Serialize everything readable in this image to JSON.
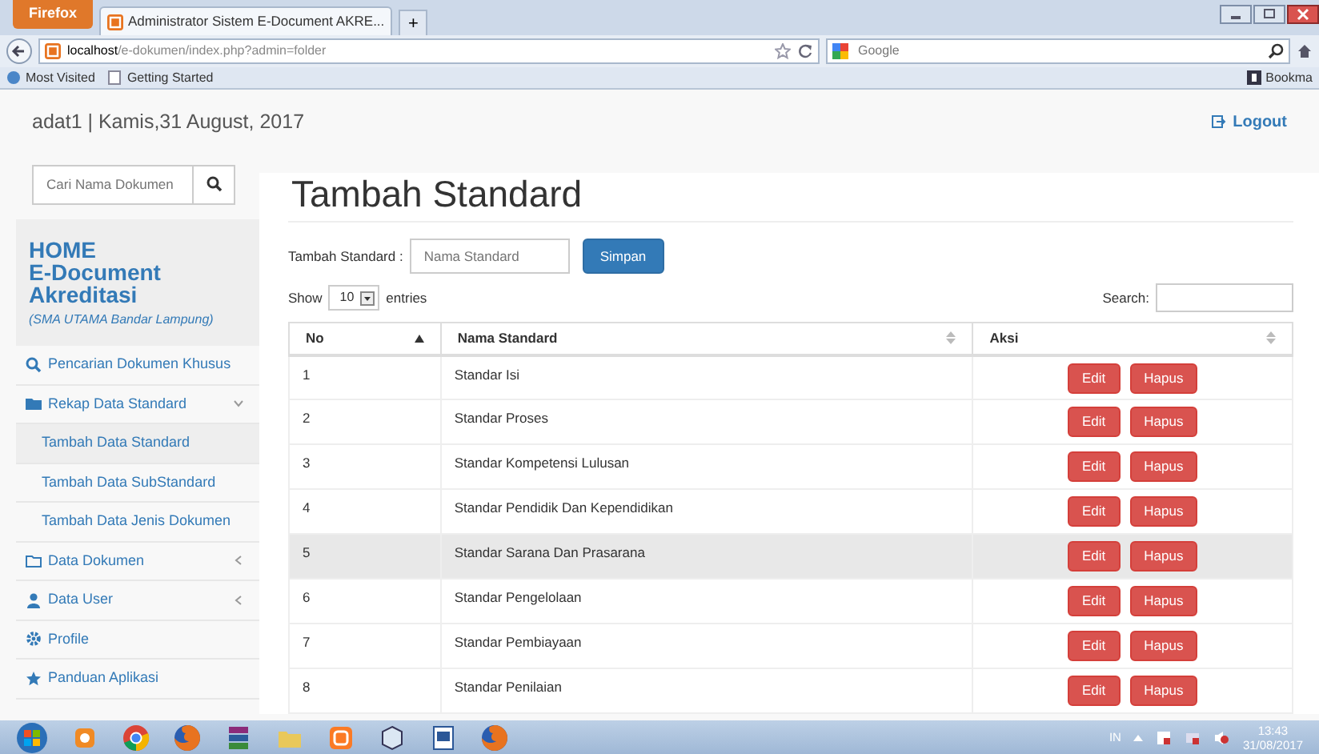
{
  "browser": {
    "menu_button": "Firefox",
    "tab_title": "Administrator Sistem E-Document AKRE...",
    "new_tab": "+",
    "url_host": "localhost",
    "url_path": "/e-dokumen/index.php?admin=folder",
    "search_engine": "Google",
    "bookmarks": [
      "Most Visited",
      "Getting Started"
    ],
    "bookmarks_menu": "Bookma"
  },
  "header": {
    "user_date": "adat1 | Kamis,31 August, 2017",
    "logout": "Logout"
  },
  "sidebar": {
    "search_placeholder": "Cari Nama Dokumen",
    "brand": [
      "HOME",
      "E-Document",
      "Akreditasi"
    ],
    "school": "(SMA UTAMA Bandar Lampung)",
    "items": [
      {
        "label": "Pencarian Dokumen Khusus",
        "kind": "link"
      },
      {
        "label": "Rekap Data Standard",
        "kind": "group",
        "expanded": true,
        "children": [
          {
            "label": "Tambah Data Standard",
            "selected": true
          },
          {
            "label": "Tambah Data SubStandard",
            "selected": false
          },
          {
            "label": "Tambah Data Jenis Dokumen",
            "selected": false
          }
        ]
      },
      {
        "label": "Data Dokumen",
        "kind": "group",
        "expanded": false
      },
      {
        "label": "Data User",
        "kind": "group",
        "expanded": false
      },
      {
        "label": "Profile",
        "kind": "link"
      },
      {
        "label": "Panduan Aplikasi",
        "kind": "link"
      }
    ]
  },
  "main": {
    "title": "Tambah Standard",
    "form": {
      "label": "Tambah Standard :",
      "placeholder": "Nama Standard",
      "button": "Simpan"
    },
    "length": {
      "show": "Show",
      "value": "10",
      "entries": "entries"
    },
    "search_label": "Search:",
    "table": {
      "columns": [
        {
          "label": "No",
          "sorted": true
        },
        {
          "label": "Nama Standard",
          "sorted": false
        },
        {
          "label": "Aksi",
          "sorted": false
        }
      ],
      "rows": [
        {
          "no": "1",
          "name": "Standar Isi",
          "highlighted": false,
          "actions": [
            "Edit",
            "Hapus"
          ]
        },
        {
          "no": "2",
          "name": "Standar Proses",
          "highlighted": false,
          "actions": [
            "Edit",
            "Hapus"
          ]
        },
        {
          "no": "3",
          "name": "Standar Kompetensi Lulusan",
          "highlighted": false,
          "actions": [
            "Edit",
            "Hapus"
          ]
        },
        {
          "no": "4",
          "name": "Standar Pendidik Dan Kependidikan",
          "highlighted": false,
          "actions": [
            "Edit",
            "Hapus"
          ]
        },
        {
          "no": "5",
          "name": "Standar Sarana Dan Prasarana",
          "highlighted": true,
          "actions": [
            "Edit",
            "Hapus"
          ]
        },
        {
          "no": "6",
          "name": "Standar Pengelolaan",
          "highlighted": false,
          "actions": [
            "Edit",
            "Hapus"
          ]
        },
        {
          "no": "7",
          "name": "Standar Pembiayaan",
          "highlighted": false,
          "actions": [
            "Edit",
            "Hapus"
          ]
        },
        {
          "no": "8",
          "name": "Standar Penilaian",
          "highlighted": false,
          "actions": [
            "Edit",
            "Hapus"
          ]
        }
      ]
    }
  },
  "taskbar": {
    "language": "IN",
    "time": "13:43",
    "date": "31/08/2017"
  }
}
